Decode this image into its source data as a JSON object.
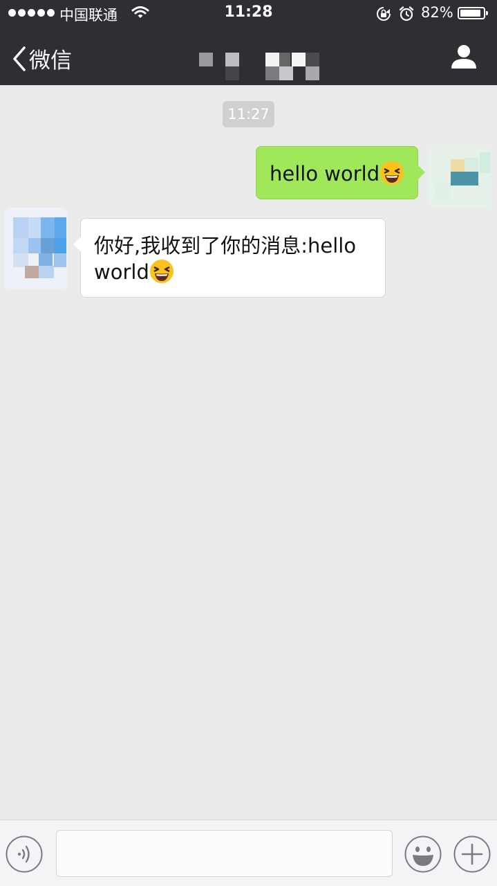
{
  "status_bar": {
    "carrier": "中国联通",
    "time": "11:28",
    "battery_percent": "82%",
    "battery_level": 0.82,
    "icons": [
      "signal-dots-icon",
      "wifi-icon",
      "rotation-lock-icon",
      "alarm-icon",
      "battery-icon"
    ]
  },
  "nav": {
    "back_label": "微信",
    "icons": [
      "chevron-left-icon",
      "person-icon"
    ]
  },
  "chat": {
    "timestamp": "11:27",
    "messages": [
      {
        "from": "me",
        "text": "hello world",
        "emoji": "laughing-face-emoji"
      },
      {
        "from": "contact",
        "text": "你好,我收到了你的消息:hello world",
        "emoji": "laughing-face-emoji"
      }
    ]
  },
  "toolbar": {
    "input_value": "",
    "icons": [
      "voice-icon",
      "emoji-icon",
      "plus-icon"
    ]
  },
  "colors": {
    "bar_bg": "#2e2e33",
    "chat_bg": "#ebebeb",
    "outgoing_bubble": "#a0e75a",
    "incoming_bubble": "#ffffff",
    "timestamp_bg": "#d0d0d0"
  }
}
